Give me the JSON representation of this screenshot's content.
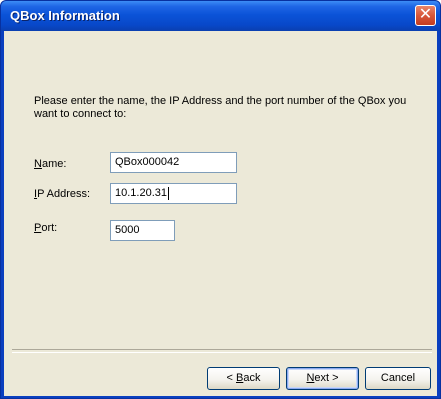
{
  "window": {
    "title": "QBox Information",
    "close_symbol": "✕"
  },
  "content": {
    "instruction": "Please enter the name, the IP Address and the port number of the QBox you want to connect to:"
  },
  "fields": {
    "name": {
      "label_key": "N",
      "label_rest": "ame:",
      "value": "QBox000042"
    },
    "ip": {
      "label_key": "I",
      "label_rest": "P Address:",
      "value": "10.1.20.31"
    },
    "port": {
      "label_key": "P",
      "label_rest": "ort:",
      "value": "5000"
    }
  },
  "buttons": {
    "back_prefix": "< ",
    "back_key": "B",
    "back_rest": "ack",
    "next_key": "N",
    "next_rest": "ext >",
    "cancel": "Cancel"
  },
  "colors": {
    "titlebar": "#0b53d8",
    "dialog_bg": "#ece9d8",
    "input_border": "#7f9db9",
    "button_border": "#003c74",
    "close_button": "#d8573a"
  }
}
